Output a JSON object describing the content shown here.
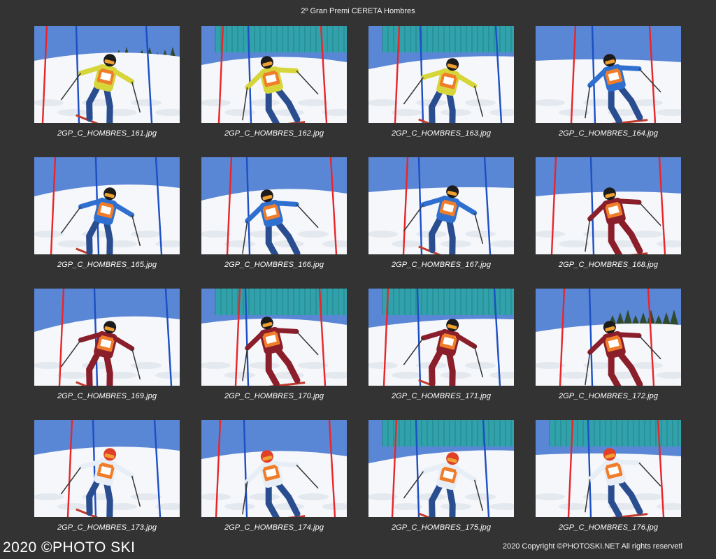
{
  "sheet": {
    "title": "2º Gran Premi CERETA Hombres"
  },
  "photos": [
    {
      "filename": "2GP_C_HOMBRES_161.jpg",
      "bg": "pine",
      "jacket": "#d6d53a",
      "pants": "#2a4d8f",
      "helmet": "#1c1c1c",
      "bib": "#f07d2a"
    },
    {
      "filename": "2GP_C_HOMBRES_162.jpg",
      "bg": "net",
      "jacket": "#d6d53a",
      "pants": "#2a4d8f",
      "helmet": "#1c1c1c",
      "bib": "#f07d2a"
    },
    {
      "filename": "2GP_C_HOMBRES_163.jpg",
      "bg": "net",
      "jacket": "#d6d53a",
      "pants": "#2a4d8f",
      "helmet": "#1c1c1c",
      "bib": "#f07d2a"
    },
    {
      "filename": "2GP_C_HOMBRES_164.jpg",
      "bg": "sky",
      "jacket": "#2f6fd0",
      "pants": "#2a4d8f",
      "helmet": "#1c1c1c",
      "bib": "#f07d2a"
    },
    {
      "filename": "2GP_C_HOMBRES_165.jpg",
      "bg": "sky",
      "jacket": "#2f6fd0",
      "pants": "#2a4d8f",
      "helmet": "#1c1c1c",
      "bib": "#f07d2a"
    },
    {
      "filename": "2GP_C_HOMBRES_166.jpg",
      "bg": "sky",
      "jacket": "#2f6fd0",
      "pants": "#2a4d8f",
      "helmet": "#1c1c1c",
      "bib": "#f07d2a"
    },
    {
      "filename": "2GP_C_HOMBRES_167.jpg",
      "bg": "sky",
      "jacket": "#2f6fd0",
      "pants": "#2a4d8f",
      "helmet": "#1c1c1c",
      "bib": "#f07d2a"
    },
    {
      "filename": "2GP_C_HOMBRES_168.jpg",
      "bg": "sky",
      "jacket": "#8a1e2a",
      "pants": "#8a1e2a",
      "helmet": "#1c1c1c",
      "bib": "#f07d2a"
    },
    {
      "filename": "2GP_C_HOMBRES_169.jpg",
      "bg": "sky",
      "jacket": "#8a1e2a",
      "pants": "#8a1e2a",
      "helmet": "#1c1c1c",
      "bib": "#f07d2a"
    },
    {
      "filename": "2GP_C_HOMBRES_170.jpg",
      "bg": "net",
      "jacket": "#8a1e2a",
      "pants": "#8a1e2a",
      "helmet": "#1c1c1c",
      "bib": "#f07d2a"
    },
    {
      "filename": "2GP_C_HOMBRES_171.jpg",
      "bg": "net",
      "jacket": "#8a1e2a",
      "pants": "#8a1e2a",
      "helmet": "#1c1c1c",
      "bib": "#f07d2a"
    },
    {
      "filename": "2GP_C_HOMBRES_172.jpg",
      "bg": "pine",
      "jacket": "#8a1e2a",
      "pants": "#8a1e2a",
      "helmet": "#1c1c1c",
      "bib": "#f07d2a"
    },
    {
      "filename": "2GP_C_HOMBRES_173.jpg",
      "bg": "sky",
      "jacket": "#e8eef6",
      "pants": "#2a4d8f",
      "helmet": "#e0402a",
      "bib": "#f07d2a"
    },
    {
      "filename": "2GP_C_HOMBRES_174.jpg",
      "bg": "sky",
      "jacket": "#e8eef6",
      "pants": "#2a4d8f",
      "helmet": "#e0402a",
      "bib": "#f07d2a"
    },
    {
      "filename": "2GP_C_HOMBRES_175.jpg",
      "bg": "net",
      "jacket": "#e8eef6",
      "pants": "#2a4d8f",
      "helmet": "#e0402a",
      "bib": "#f07d2a"
    },
    {
      "filename": "2GP_C_HOMBRES_176.jpg",
      "bg": "net",
      "jacket": "#e8eef6",
      "pants": "#2a4d8f",
      "helmet": "#e0402a",
      "bib": "#f07d2a"
    }
  ],
  "footer": {
    "watermark": "2020 ©PHOTO SKI",
    "copyright": "2020 Copyright ©PHOTOSKI.NET All rights reservetl"
  },
  "colors": {
    "background": "#333333",
    "gate_red": "#e8262a",
    "gate_blue": "#1d4fc4",
    "sky": "#5a86d6",
    "snow": "#f5f7fa"
  }
}
